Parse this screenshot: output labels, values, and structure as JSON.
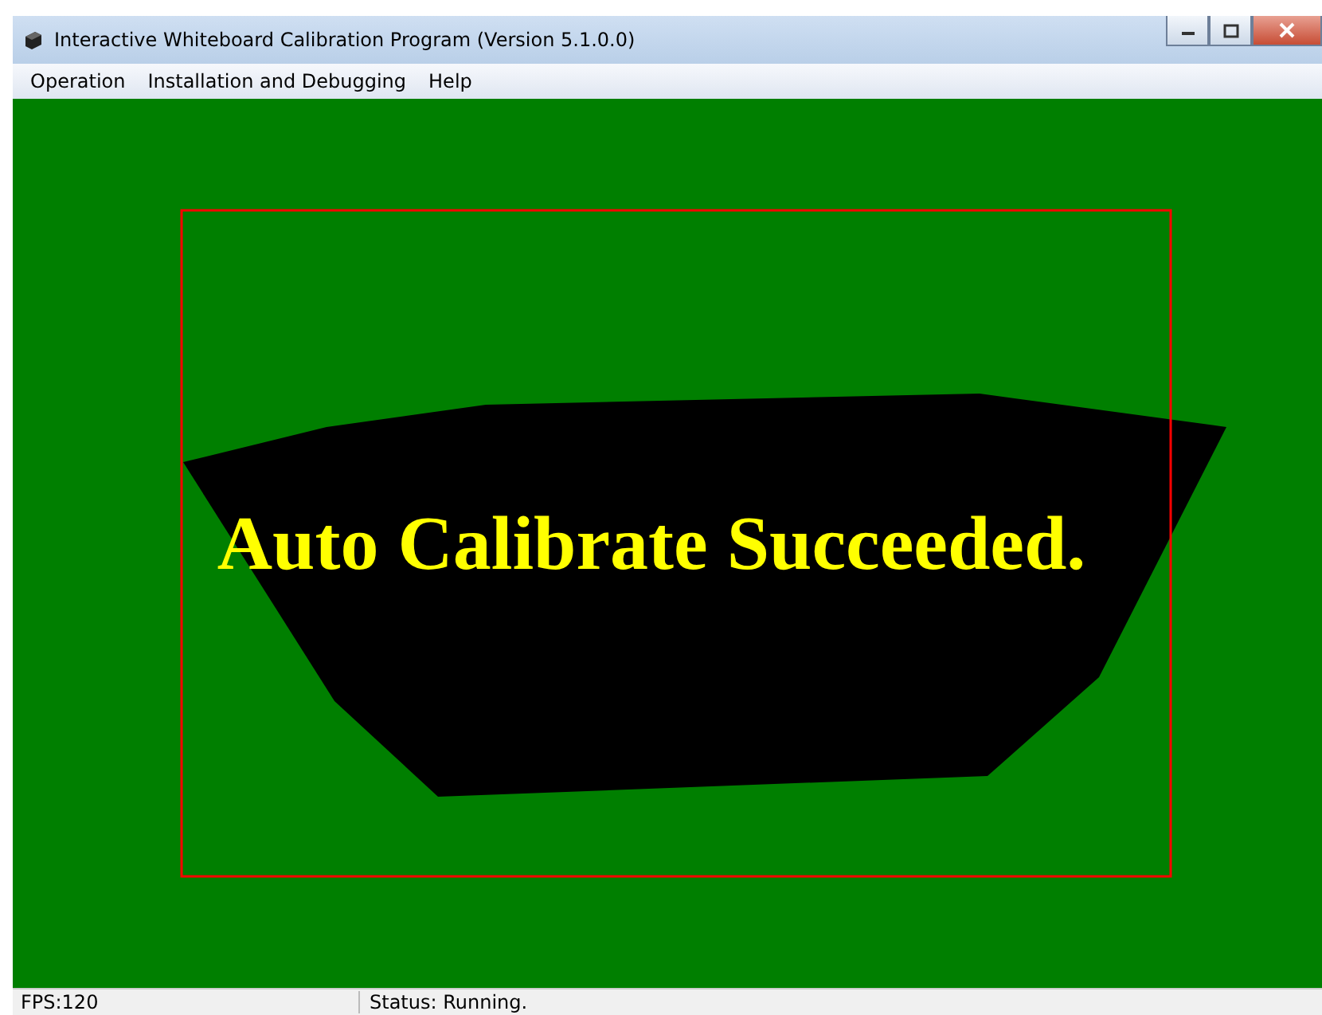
{
  "window": {
    "title": "Interactive Whiteboard Calibration Program (Version 5.1.0.0)"
  },
  "menu": [
    "Operation",
    "Installation and Debugging",
    "Help"
  ],
  "canvas": {
    "message": "Auto Calibrate Succeeded."
  },
  "status_bar": {
    "fps": "FPS:120",
    "status": "Status: Running."
  }
}
